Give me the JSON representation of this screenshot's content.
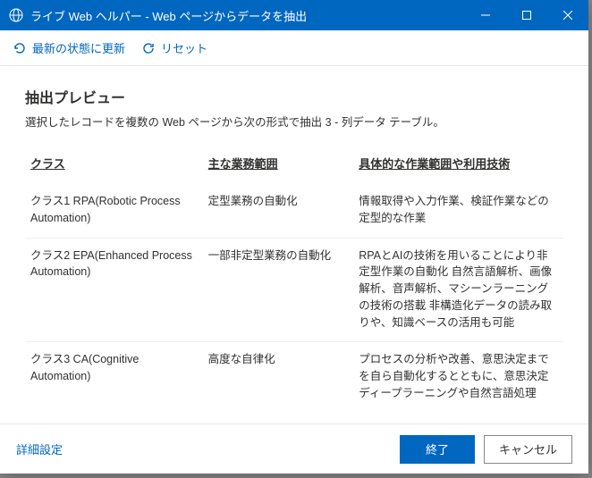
{
  "titlebar": {
    "title": "ライブ Web ヘルパー - Web ページからデータを抽出"
  },
  "toolbar": {
    "refresh": "最新の状態に更新",
    "reset": "リセット"
  },
  "preview": {
    "heading": "抽出プレビュー",
    "subtitle": "選択したレコードを複数の Web ページから次の形式で抽出 3 - 列データ テーブル。"
  },
  "columns": {
    "c1": "クラス",
    "c2": "主な業務範囲",
    "c3": "具体的な作業範囲や利用技術"
  },
  "rows": [
    {
      "c1": "クラス1 RPA(Robotic Process Automation)",
      "c2": "定型業務の自動化",
      "c3": "情報取得や入力作業、検証作業などの定型的な作業"
    },
    {
      "c1": "クラス2 EPA(Enhanced Process Automation)",
      "c2": "一部非定型業務の自動化",
      "c3": "RPAとAIの技術を用いることにより非定型作業の自動化\n自然言語解析、画像解析、音声解析、マシーンラーニングの技術の搭載\n非構造化データの読み取りや、知識ベースの活用も可能"
    },
    {
      "c1": "クラス3 CA(Cognitive Automation)",
      "c2": "高度な自律化",
      "c3": "プロセスの分析や改善、意思決定までを自ら自動化するとともに、意思決定\nディープラーニングや自然言語処理"
    }
  ],
  "footer": {
    "advanced": "詳細設定",
    "finish": "終了",
    "cancel": "キャンセル"
  }
}
